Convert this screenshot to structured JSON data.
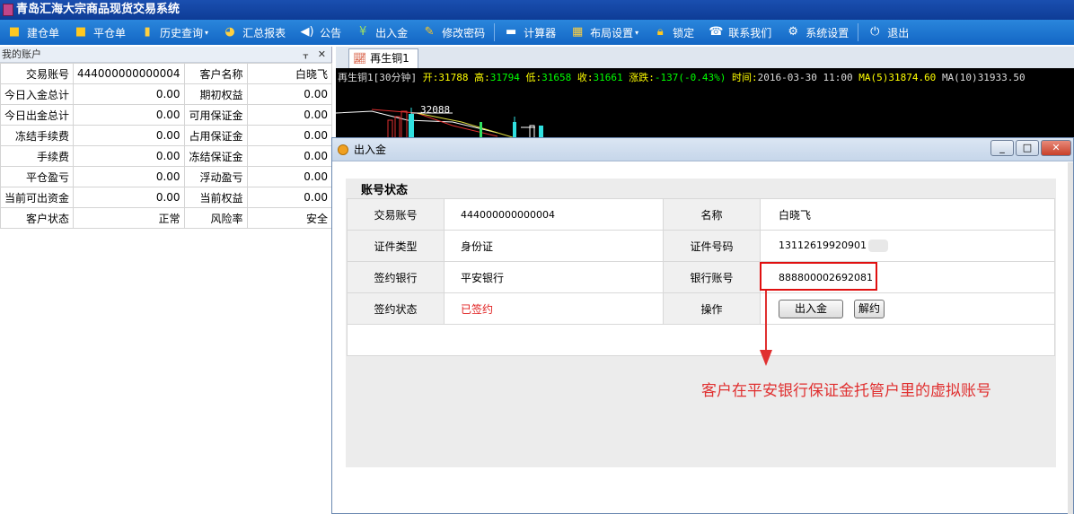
{
  "app": {
    "title": "青岛汇海大宗商品现货交易系统"
  },
  "toolbar": {
    "build_order": "建仓单",
    "close_order": "平仓单",
    "history": "历史查询",
    "summary": "汇总报表",
    "notice": "公告",
    "deposit_withdraw": "出入金",
    "change_password": "修改密码",
    "calculator": "计算器",
    "layout": "布局设置",
    "lock": "锁定",
    "contact": "联系我们",
    "settings": "系统设置",
    "exit": "退出"
  },
  "left_panel": {
    "title": "我的账户",
    "pin": "ᚁ",
    "close": "✕",
    "rows": [
      {
        "k1": "交易账号",
        "v1": "444000000000004",
        "k2": "客户名称",
        "v2": "白晓飞"
      },
      {
        "k1": "今日入金总计",
        "v1": "0.00",
        "k2": "期初权益",
        "v2": "0.00"
      },
      {
        "k1": "今日出金总计",
        "v1": "0.00",
        "k2": "可用保证金",
        "v2": "0.00"
      },
      {
        "k1": "冻结手续费",
        "v1": "0.00",
        "k2": "占用保证金",
        "v2": "0.00"
      },
      {
        "k1": "手续费",
        "v1": "0.00",
        "k2": "冻结保证金",
        "v2": "0.00"
      },
      {
        "k1": "平仓盈亏",
        "v1": "0.00",
        "k2": "浮动盈亏",
        "v2": "0.00"
      },
      {
        "k1": "当前可出资金",
        "v1": "0.00",
        "k2": "当前权益",
        "v2": "0.00"
      },
      {
        "k1": "客户状态",
        "v1": "正常",
        "k2": "风险率",
        "v2": "安全"
      }
    ]
  },
  "chart": {
    "tab": "再生铜1",
    "product": "再生铜1",
    "period": "[30分钟]",
    "open_label": "开:",
    "open": "31788",
    "high_label": "高:",
    "high": "31794",
    "low_label": "低:",
    "low": "31658",
    "close_label": "收:",
    "close": "31661",
    "change_label": "涨跌:",
    "change": "-137(-0.43%)",
    "time_label": "时间:",
    "time": "2016-03-30 11:00",
    "ma5_label": "MA(5)",
    "ma5": "31874.60",
    "ma10_label": "MA(10)",
    "ma10": "31933.50",
    "peak_label": "32088"
  },
  "dialog": {
    "title": "出入金",
    "min": "_",
    "max": "□",
    "close": "✕",
    "section_title": "账号状态",
    "trade_account_label": "交易账号",
    "trade_account": "444000000000004",
    "name_label": "名称",
    "name": "白晓飞",
    "id_type_label": "证件类型",
    "id_type": "身份证",
    "id_number_label": "证件号码",
    "id_number": "13112619920901",
    "bank_label": "签约银行",
    "bank": "平安银行",
    "bank_account_label": "银行账号",
    "bank_account": "888800002692081",
    "sign_status_label": "签约状态",
    "sign_status": "已签约",
    "operation_label": "操作",
    "inout_button": "出入金",
    "unsign_button": "解约"
  },
  "annotation": "客户在平安银行保证金托管户里的虚拟账号",
  "colors": {
    "annotation": "#e03030",
    "signed": "#e02020",
    "toolbar": "#1a76d2"
  }
}
